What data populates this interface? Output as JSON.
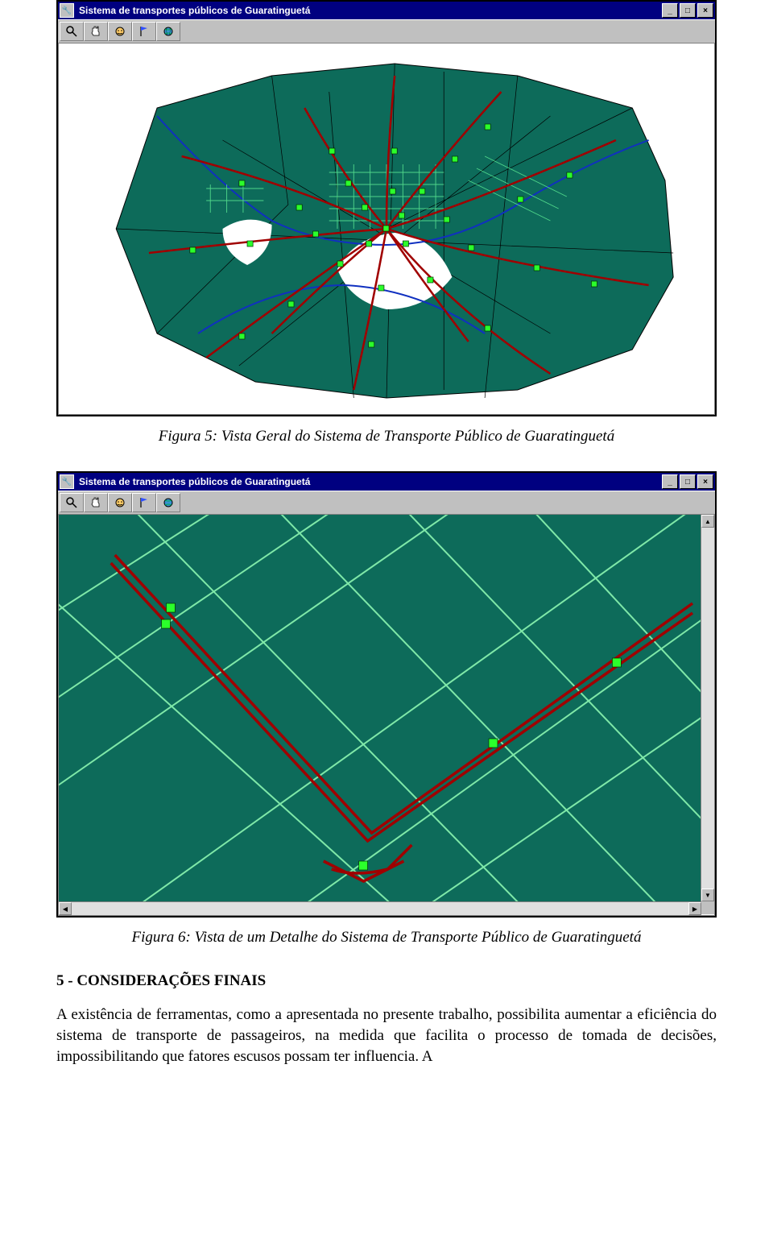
{
  "window": {
    "title": "Sistema de transportes públicos de Guaratinguetá",
    "minimize_label": "_",
    "maximize_label": "□",
    "close_label": "×",
    "app_icon_glyph": "🔧"
  },
  "toolbar": {
    "items": [
      {
        "name": "zoom-tool",
        "icon": "magnifier"
      },
      {
        "name": "pan-tool",
        "icon": "hand"
      },
      {
        "name": "identify-tool",
        "icon": "face"
      },
      {
        "name": "flag-tool",
        "icon": "flag"
      },
      {
        "name": "full-extent-tool",
        "icon": "globe"
      }
    ]
  },
  "figures": {
    "fig5_caption": "Figura 5: Vista Geral do Sistema de Transporte Público de Guaratinguetá",
    "fig6_caption": "Figura 6: Vista de um Detalhe do Sistema de Transporte Público de Guaratinguetá"
  },
  "section": {
    "heading": "5 - CONSIDERAÇÕES FINAIS",
    "paragraph": "A existência de ferramentas, como a apresentada no presente trabalho, possibilita aumentar a eficiência do sistema de transporte de passageiros, na medida que facilita o processo de tomada de decisões, impossibilitando que fatores escusos possam ter influencia. A"
  },
  "scrollbar_glyphs": {
    "up": "▲",
    "down": "▼",
    "left": "◀",
    "right": "▶"
  }
}
